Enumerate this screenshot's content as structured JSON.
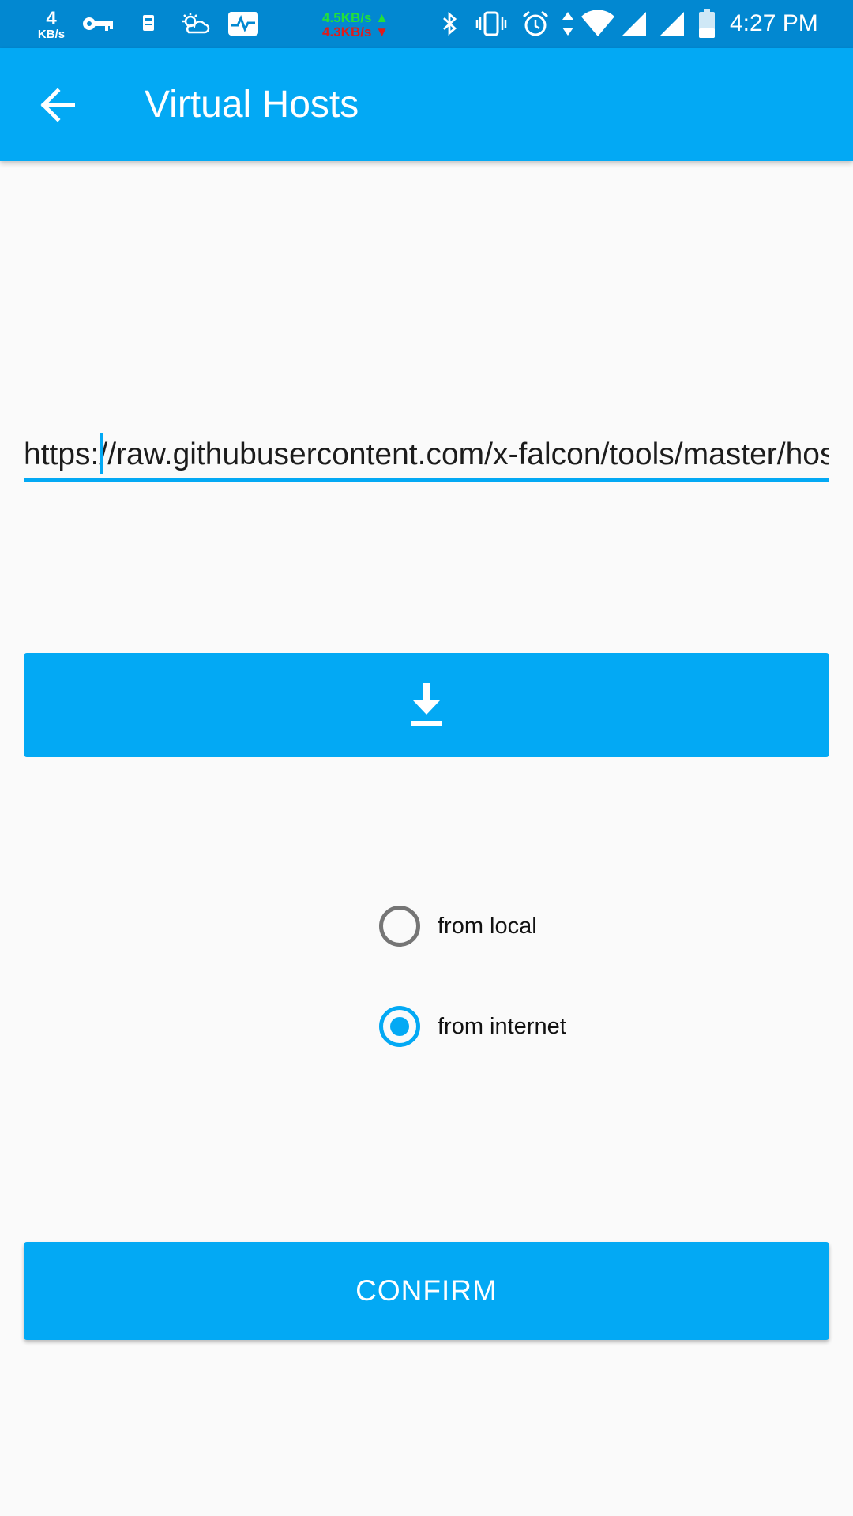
{
  "status_bar": {
    "net_rate": "4",
    "net_unit": "KB/s",
    "upload_speed": "4.5KB/s ▲",
    "download_speed": "4.3KB/s ▼",
    "time": "4:27 PM",
    "icons": [
      "vpn-key-icon",
      "sim-icon",
      "weather-icon",
      "activity-icon",
      "bluetooth-icon",
      "vibrate-icon",
      "alarm-icon",
      "data-arrows-icon",
      "wifi-icon",
      "signal-icon",
      "signal-icon",
      "battery-icon"
    ]
  },
  "app_bar": {
    "title": "Virtual Hosts",
    "back_icon": "arrow-back-icon"
  },
  "url_input": {
    "value": "https://raw.githubusercontent.com/x-falcon/tools/master/hosts"
  },
  "download": {
    "icon": "download-icon"
  },
  "source": {
    "options": [
      {
        "label": "from local",
        "checked": false
      },
      {
        "label": "from internet",
        "checked": true
      }
    ]
  },
  "confirm": {
    "label": "CONFIRM"
  },
  "colors": {
    "primary": "#03a9f4",
    "primary_dark": "#0288d1",
    "background": "#fafafa"
  }
}
